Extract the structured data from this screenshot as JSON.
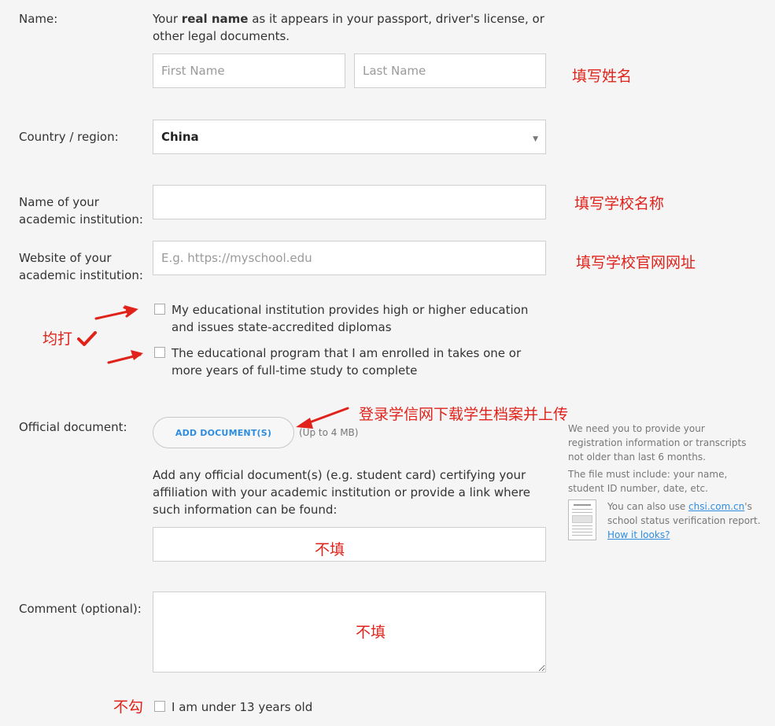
{
  "name_section": {
    "label": "Name:",
    "intro_before": "Your ",
    "intro_bold": "real name",
    "intro_after": " as it appears in your passport, driver's license, or other legal documents.",
    "first_placeholder": "First Name",
    "last_placeholder": "Last Name",
    "annotation": "填写姓名"
  },
  "country": {
    "label": "Country / region:",
    "value": "China",
    "caret": "▼"
  },
  "institution": {
    "label": "Name of your academic institution:",
    "annotation": "填写学校名称"
  },
  "website": {
    "label": "Website of your academic institution:",
    "placeholder": "E.g. https://myschool.edu",
    "annotation": "填写学校官网网址"
  },
  "checks": {
    "higher_ed": "My educational institution provides high or higher education and issues state-accredited diplomas",
    "full_time": "The educational program that I am enrolled in takes one or more years of full-time study to complete",
    "annotation": "均打"
  },
  "document": {
    "label": "Official document:",
    "button": "ADD DOCUMENT(S)",
    "limit": "(Up to 4 MB)",
    "annotation": "登录学信网下载学生档案并上传",
    "help": "Add any official document(s) (e.g. student card) certifying your affiliation with your academic institution or provide a link where such information can be found:",
    "link_annotation": "不填"
  },
  "side_note": {
    "p1": "We need you to provide your registration information or transcripts not older than last 6 months.",
    "p2": "The file must include: your name, student ID number, date, etc.",
    "p3_before": "You can also use ",
    "p3_link": "chsi.com.cn",
    "p3_after": "'s school status verification report.",
    "p3_link2": "How it looks?"
  },
  "comment": {
    "label": "Comment (optional):",
    "annotation": "不填"
  },
  "age": {
    "text": "I am under 13 years old",
    "annotation": "不勾"
  },
  "colors": {
    "annotation_red": "#e0221a",
    "link_blue": "#2e8de0",
    "background": "#f5f5f5"
  }
}
